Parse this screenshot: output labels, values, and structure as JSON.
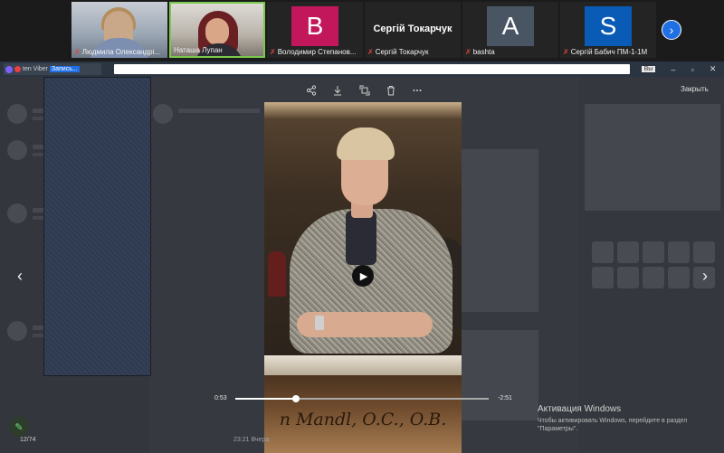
{
  "participants": [
    {
      "name": "Людмила Олександрі...",
      "muted": true,
      "type": "camera"
    },
    {
      "name": "Наташа Лупан",
      "muted": false,
      "type": "camera",
      "speaking": true
    },
    {
      "name": "Володимир Степанов...",
      "muted": true,
      "type": "avatar",
      "initial": "B",
      "color": "#c2185b"
    },
    {
      "name": "Сергій Токарчук",
      "display": "Сергій Токарчук",
      "muted": true,
      "type": "name"
    },
    {
      "name": "bashta",
      "muted": true,
      "type": "avatar",
      "initial": "A",
      "color": "#4a5563"
    },
    {
      "name": "Сергій Бабич ПМ-1-1М",
      "muted": true,
      "type": "avatar",
      "initial": "S",
      "color": "#0a5bb5"
    }
  ],
  "window": {
    "tab_label_1": "ten Viber",
    "tab_label_2": "Запись...",
    "exit_label": "Вы",
    "minimize": "–",
    "restore": "▫",
    "close": "✕"
  },
  "viewer": {
    "close_label": "Закрыть",
    "caption": "n Mandl, O.C., O.B.",
    "time_elapsed": "0:53",
    "time_remaining": "-2:51",
    "progress": 0.24,
    "counter": "12/74",
    "message_time": "23:21 Вчера"
  },
  "activation": {
    "title": "Активация Windows",
    "text": "Чтобы активировать Windows, перейдите в раздел \"Параметры\"."
  },
  "icons": {
    "share": "share-icon",
    "download": "download-icon",
    "rotate": "rotate-icon",
    "delete": "trash-icon",
    "more": "more-icon"
  },
  "colors": {
    "accent": "#1f6fe5",
    "muted_mic": "#e0443e",
    "speaking_border": "#7ac94d"
  }
}
